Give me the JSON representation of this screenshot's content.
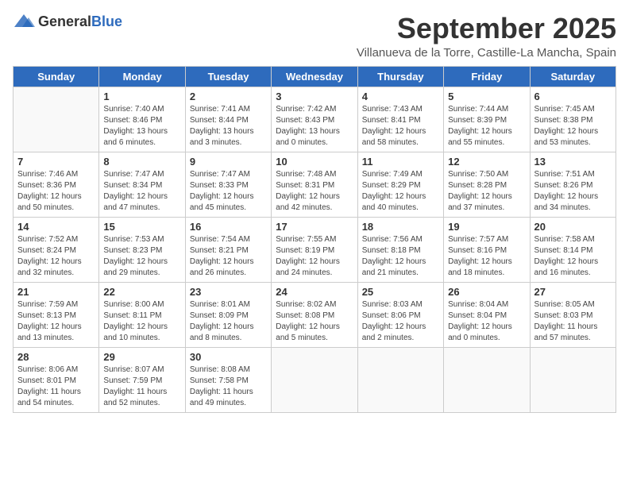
{
  "logo": {
    "text_general": "General",
    "text_blue": "Blue"
  },
  "header": {
    "month_title": "September 2025",
    "subtitle": "Villanueva de la Torre, Castille-La Mancha, Spain"
  },
  "weekdays": [
    "Sunday",
    "Monday",
    "Tuesday",
    "Wednesday",
    "Thursday",
    "Friday",
    "Saturday"
  ],
  "weeks": [
    [
      {
        "day": "",
        "info": ""
      },
      {
        "day": "1",
        "info": "Sunrise: 7:40 AM\nSunset: 8:46 PM\nDaylight: 13 hours\nand 6 minutes."
      },
      {
        "day": "2",
        "info": "Sunrise: 7:41 AM\nSunset: 8:44 PM\nDaylight: 13 hours\nand 3 minutes."
      },
      {
        "day": "3",
        "info": "Sunrise: 7:42 AM\nSunset: 8:43 PM\nDaylight: 13 hours\nand 0 minutes."
      },
      {
        "day": "4",
        "info": "Sunrise: 7:43 AM\nSunset: 8:41 PM\nDaylight: 12 hours\nand 58 minutes."
      },
      {
        "day": "5",
        "info": "Sunrise: 7:44 AM\nSunset: 8:39 PM\nDaylight: 12 hours\nand 55 minutes."
      },
      {
        "day": "6",
        "info": "Sunrise: 7:45 AM\nSunset: 8:38 PM\nDaylight: 12 hours\nand 53 minutes."
      }
    ],
    [
      {
        "day": "7",
        "info": "Sunrise: 7:46 AM\nSunset: 8:36 PM\nDaylight: 12 hours\nand 50 minutes."
      },
      {
        "day": "8",
        "info": "Sunrise: 7:47 AM\nSunset: 8:34 PM\nDaylight: 12 hours\nand 47 minutes."
      },
      {
        "day": "9",
        "info": "Sunrise: 7:47 AM\nSunset: 8:33 PM\nDaylight: 12 hours\nand 45 minutes."
      },
      {
        "day": "10",
        "info": "Sunrise: 7:48 AM\nSunset: 8:31 PM\nDaylight: 12 hours\nand 42 minutes."
      },
      {
        "day": "11",
        "info": "Sunrise: 7:49 AM\nSunset: 8:29 PM\nDaylight: 12 hours\nand 40 minutes."
      },
      {
        "day": "12",
        "info": "Sunrise: 7:50 AM\nSunset: 8:28 PM\nDaylight: 12 hours\nand 37 minutes."
      },
      {
        "day": "13",
        "info": "Sunrise: 7:51 AM\nSunset: 8:26 PM\nDaylight: 12 hours\nand 34 minutes."
      }
    ],
    [
      {
        "day": "14",
        "info": "Sunrise: 7:52 AM\nSunset: 8:24 PM\nDaylight: 12 hours\nand 32 minutes."
      },
      {
        "day": "15",
        "info": "Sunrise: 7:53 AM\nSunset: 8:23 PM\nDaylight: 12 hours\nand 29 minutes."
      },
      {
        "day": "16",
        "info": "Sunrise: 7:54 AM\nSunset: 8:21 PM\nDaylight: 12 hours\nand 26 minutes."
      },
      {
        "day": "17",
        "info": "Sunrise: 7:55 AM\nSunset: 8:19 PM\nDaylight: 12 hours\nand 24 minutes."
      },
      {
        "day": "18",
        "info": "Sunrise: 7:56 AM\nSunset: 8:18 PM\nDaylight: 12 hours\nand 21 minutes."
      },
      {
        "day": "19",
        "info": "Sunrise: 7:57 AM\nSunset: 8:16 PM\nDaylight: 12 hours\nand 18 minutes."
      },
      {
        "day": "20",
        "info": "Sunrise: 7:58 AM\nSunset: 8:14 PM\nDaylight: 12 hours\nand 16 minutes."
      }
    ],
    [
      {
        "day": "21",
        "info": "Sunrise: 7:59 AM\nSunset: 8:13 PM\nDaylight: 12 hours\nand 13 minutes."
      },
      {
        "day": "22",
        "info": "Sunrise: 8:00 AM\nSunset: 8:11 PM\nDaylight: 12 hours\nand 10 minutes."
      },
      {
        "day": "23",
        "info": "Sunrise: 8:01 AM\nSunset: 8:09 PM\nDaylight: 12 hours\nand 8 minutes."
      },
      {
        "day": "24",
        "info": "Sunrise: 8:02 AM\nSunset: 8:08 PM\nDaylight: 12 hours\nand 5 minutes."
      },
      {
        "day": "25",
        "info": "Sunrise: 8:03 AM\nSunset: 8:06 PM\nDaylight: 12 hours\nand 2 minutes."
      },
      {
        "day": "26",
        "info": "Sunrise: 8:04 AM\nSunset: 8:04 PM\nDaylight: 12 hours\nand 0 minutes."
      },
      {
        "day": "27",
        "info": "Sunrise: 8:05 AM\nSunset: 8:03 PM\nDaylight: 11 hours\nand 57 minutes."
      }
    ],
    [
      {
        "day": "28",
        "info": "Sunrise: 8:06 AM\nSunset: 8:01 PM\nDaylight: 11 hours\nand 54 minutes."
      },
      {
        "day": "29",
        "info": "Sunrise: 8:07 AM\nSunset: 7:59 PM\nDaylight: 11 hours\nand 52 minutes."
      },
      {
        "day": "30",
        "info": "Sunrise: 8:08 AM\nSunset: 7:58 PM\nDaylight: 11 hours\nand 49 minutes."
      },
      {
        "day": "",
        "info": ""
      },
      {
        "day": "",
        "info": ""
      },
      {
        "day": "",
        "info": ""
      },
      {
        "day": "",
        "info": ""
      }
    ]
  ]
}
